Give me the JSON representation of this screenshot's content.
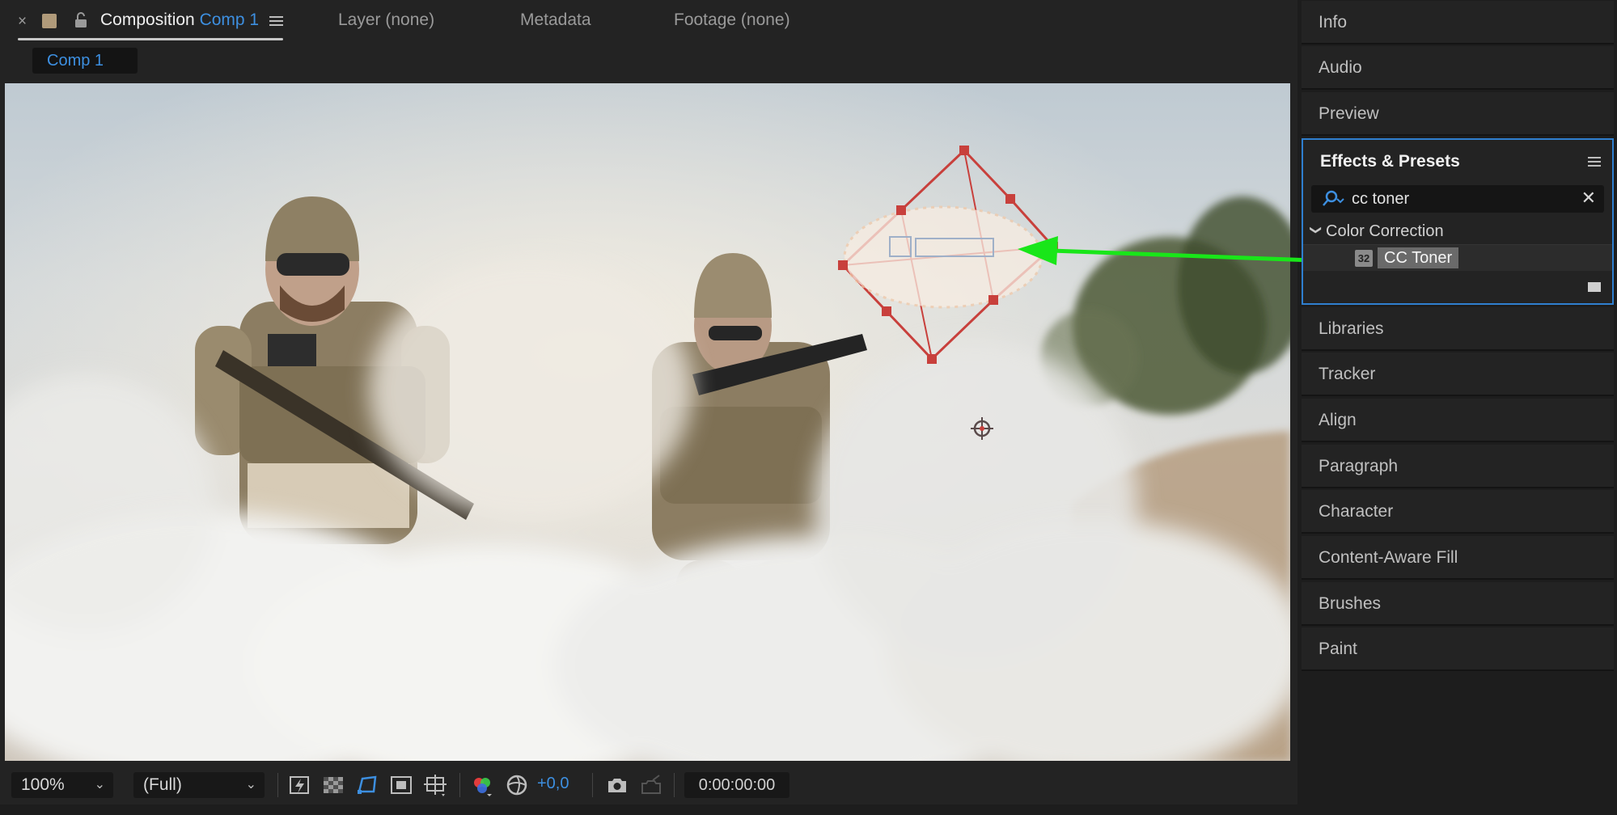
{
  "window": {
    "close_glyph": "×",
    "tabs": {
      "composition_label": "Composition",
      "composition_name": "Comp 1",
      "layer": "Layer (none)",
      "metadata": "Metadata",
      "footage": "Footage (none)"
    },
    "comp_subtab": "Comp 1"
  },
  "viewer": {
    "scene": "two soldiers in camouflage with rifles walking through white smoke",
    "callout_color": "#19e619",
    "path_color": "#c8403c"
  },
  "viewer_bar": {
    "zoom": "100%",
    "resolution": "(Full)",
    "exposure": "+0,0",
    "timecode": "0:00:00:00",
    "icons": [
      "fast-preview-icon",
      "transparency-grid-icon",
      "mask-visibility-icon",
      "region-of-interest-icon",
      "grid-guides-icon",
      "color-channels-icon",
      "reset-exposure-icon",
      "snapshot-icon",
      "show-snapshot-icon"
    ]
  },
  "right_panels": {
    "info": "Info",
    "audio": "Audio",
    "preview": "Preview",
    "effects": {
      "title": "Effects & Presets",
      "search_value": "cc toner",
      "folder": "Color Correction",
      "bit_depth": "32",
      "effect": "CC Toner"
    },
    "libraries": "Libraries",
    "tracker": "Tracker",
    "align": "Align",
    "paragraph": "Paragraph",
    "character": "Character",
    "content_aware_fill": "Content-Aware Fill",
    "brushes": "Brushes",
    "paint": "Paint"
  },
  "colors": {
    "accent": "#3d8fe0",
    "panel_bg": "#232323",
    "focus_border": "#2f7fcf"
  }
}
